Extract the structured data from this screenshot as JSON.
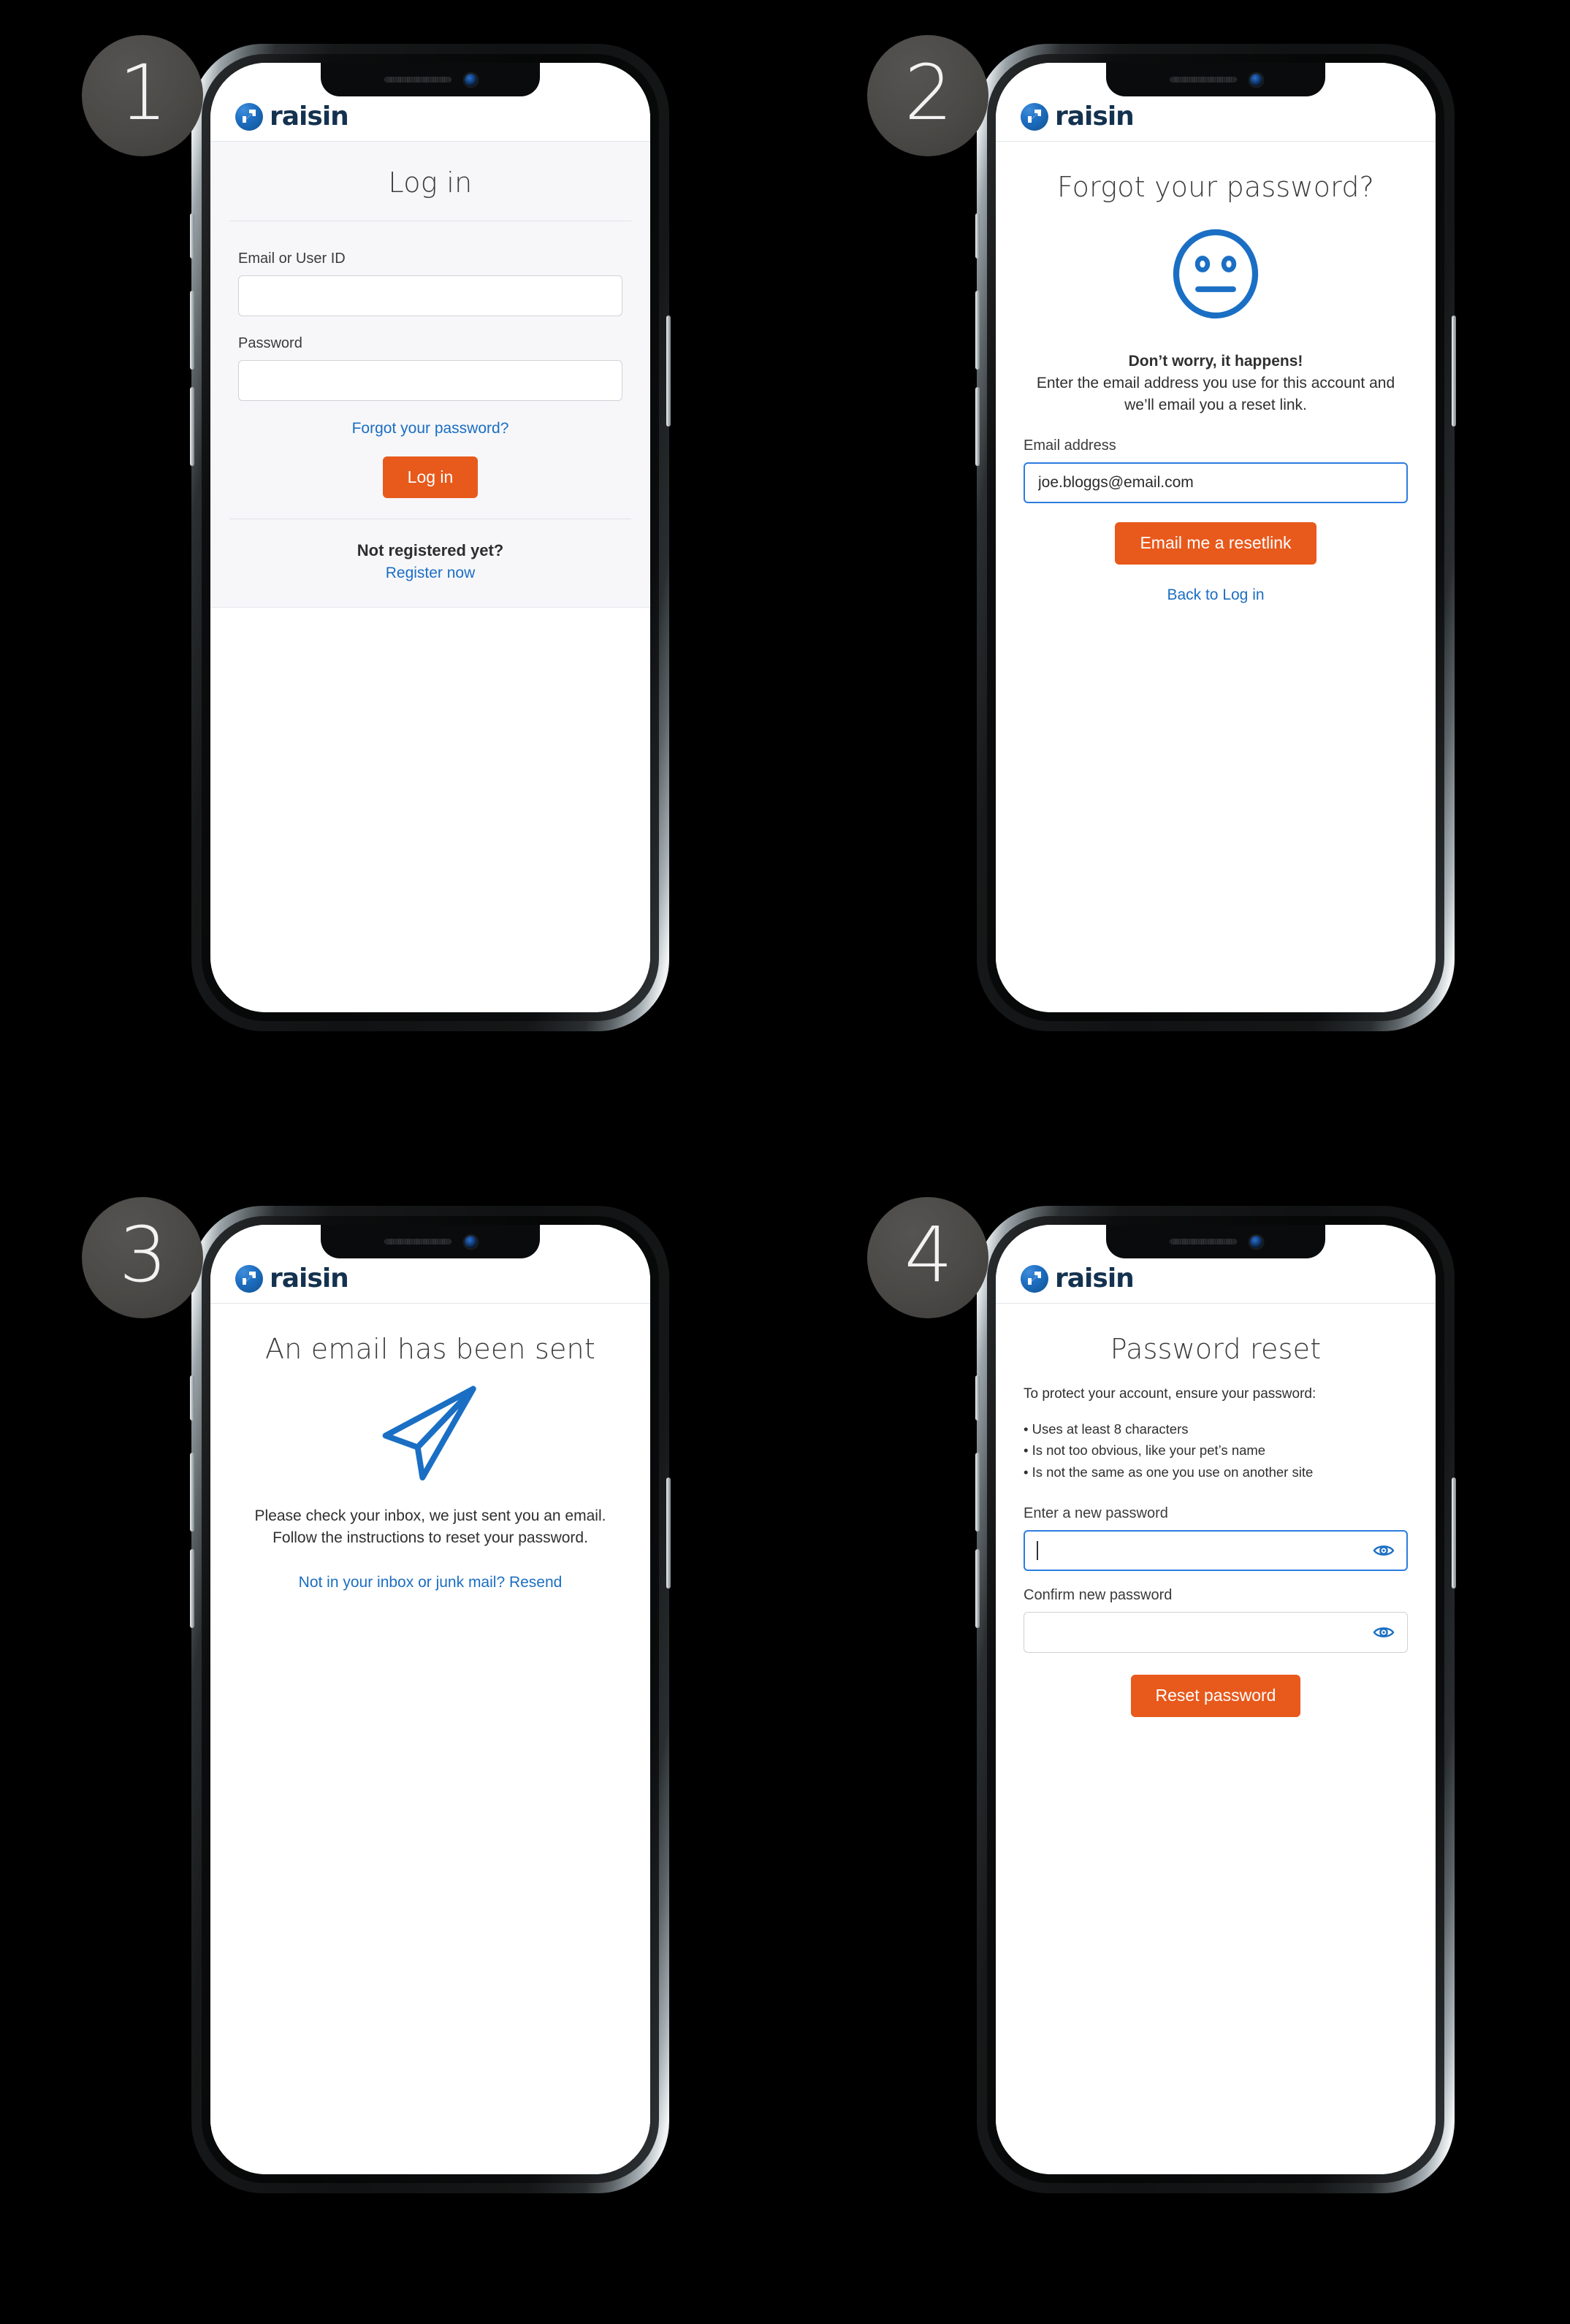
{
  "brand": {
    "logo_word": "raisin",
    "logo_mark_name": "raisin-arrow-logo",
    "accent_blue": "#1b6ec2",
    "accent_orange": "#e8591c",
    "logo_navy": "#14324f"
  },
  "steps": [
    {
      "number": "1"
    },
    {
      "number": "2"
    },
    {
      "number": "3"
    },
    {
      "number": "4"
    }
  ],
  "screen1": {
    "title": "Log in",
    "email_label": "Email or User ID",
    "email_value": "",
    "email_placeholder": "",
    "password_label": "Password",
    "password_value": "",
    "password_placeholder": "",
    "forgot_link": "Forgot your password?",
    "login_button": "Log in",
    "not_registered": "Not registered yet?",
    "register_link": "Register now"
  },
  "screen2": {
    "title": "Forgot your password?",
    "illustration": "neutral-face-icon",
    "headline": "Don’t worry, it happens!",
    "body": "Enter the email address you use for this account and we’ll email you a reset link.",
    "email_label": "Email address",
    "email_value": "joe.bloggs@email.com",
    "email_placeholder": "",
    "submit_button": "Email me a  resetlink",
    "back_link": "Back to Log in"
  },
  "screen3": {
    "title": "An email has been sent",
    "illustration": "paper-plane-icon",
    "body": "Please check your inbox, we just sent you an email. Follow the instructions to reset your password.",
    "resend_link": "Not in your inbox or junk mail? Resend"
  },
  "screen4": {
    "title": "Password reset",
    "lead": "To protect your account, ensure your password:",
    "rules": [
      "• Uses at least 8 characters",
      "• Is not too obvious, like your pet’s name",
      "• Is not the same as one you use on another site"
    ],
    "new_password_label": "Enter a new password",
    "new_password_value": "",
    "new_password_placeholder": "",
    "confirm_password_label": "Confirm new password",
    "confirm_password_value": "",
    "confirm_password_placeholder": "",
    "reveal_icon": "eye-icon",
    "submit_button": "Reset password"
  }
}
